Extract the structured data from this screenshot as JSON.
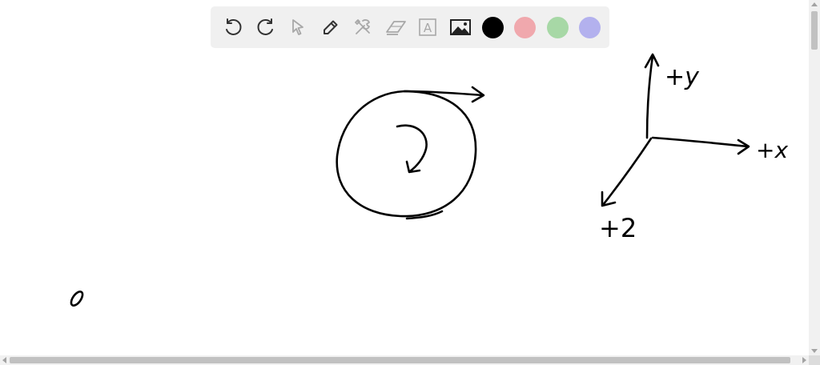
{
  "toolbar": {
    "tools": [
      {
        "name": "undo",
        "icon": "undo-icon"
      },
      {
        "name": "redo",
        "icon": "redo-icon"
      },
      {
        "name": "select",
        "icon": "pointer-icon"
      },
      {
        "name": "pen",
        "icon": "pen-icon"
      },
      {
        "name": "tools",
        "icon": "tools-icon"
      },
      {
        "name": "eraser",
        "icon": "eraser-icon"
      },
      {
        "name": "text",
        "icon": "text-icon"
      },
      {
        "name": "image",
        "icon": "image-icon"
      }
    ],
    "text_tool_glyph": "A",
    "colors": {
      "black": "#000000",
      "red": "#f0a8ad",
      "green": "#a7d8a6",
      "purple": "#b3b1ee"
    },
    "icon_color": "#333333",
    "disabled_icon_color": "#a8a8a8"
  },
  "drawing": {
    "stroke_color": "#000000",
    "axis_labels": {
      "y": "+y",
      "x": "+x",
      "z": "+2"
    },
    "stray_mark": "o"
  }
}
